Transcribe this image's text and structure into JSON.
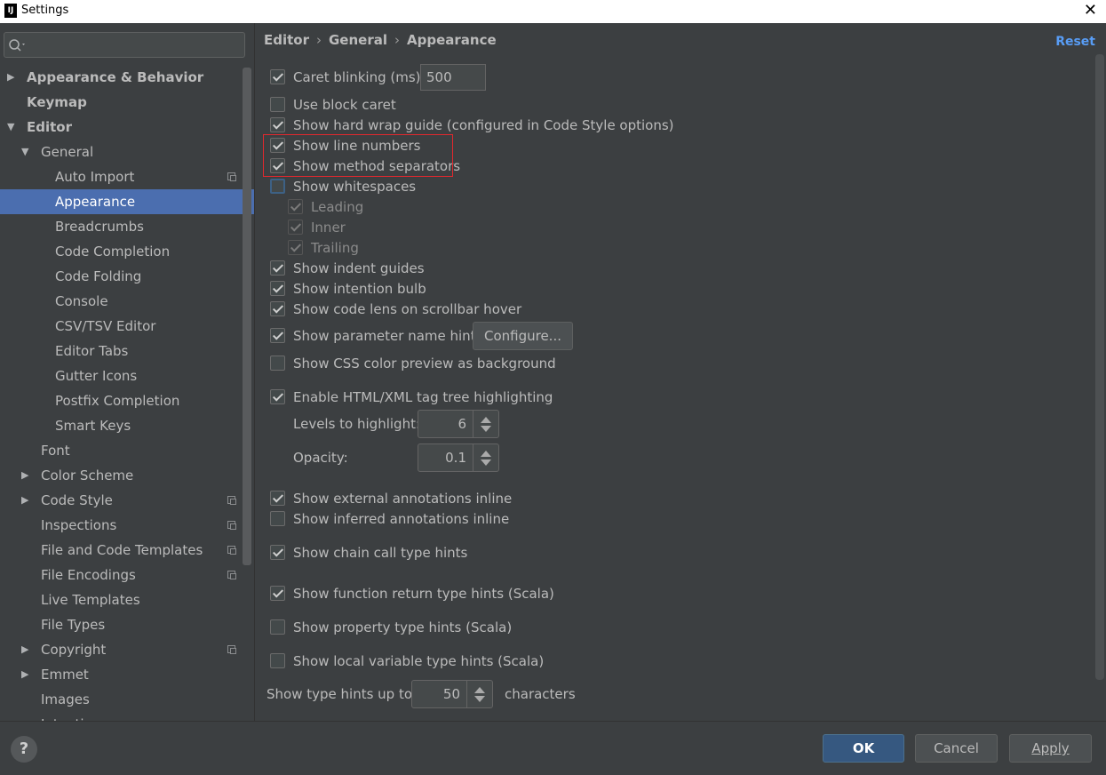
{
  "window": {
    "title": "Settings",
    "app_icon_text": "IJ"
  },
  "search": {
    "placeholder": "",
    "icon": "search-icon"
  },
  "sidebar": {
    "items": [
      {
        "label": "Appearance & Behavior",
        "level": 0,
        "arrow": "collapsed",
        "bold": true
      },
      {
        "label": "Keymap",
        "level": 0,
        "bold": true
      },
      {
        "label": "Editor",
        "level": 0,
        "arrow": "expanded",
        "bold": true
      },
      {
        "label": "General",
        "level": 1,
        "arrow": "expanded"
      },
      {
        "label": "Auto Import",
        "level": 2,
        "project": true
      },
      {
        "label": "Appearance",
        "level": 2,
        "selected": true
      },
      {
        "label": "Breadcrumbs",
        "level": 2
      },
      {
        "label": "Code Completion",
        "level": 2
      },
      {
        "label": "Code Folding",
        "level": 2
      },
      {
        "label": "Console",
        "level": 2
      },
      {
        "label": "CSV/TSV Editor",
        "level": 2
      },
      {
        "label": "Editor Tabs",
        "level": 2
      },
      {
        "label": "Gutter Icons",
        "level": 2
      },
      {
        "label": "Postfix Completion",
        "level": 2
      },
      {
        "label": "Smart Keys",
        "level": 2
      },
      {
        "label": "Font",
        "level": 1
      },
      {
        "label": "Color Scheme",
        "level": 1,
        "arrow": "collapsed"
      },
      {
        "label": "Code Style",
        "level": 1,
        "arrow": "collapsed",
        "project": true
      },
      {
        "label": "Inspections",
        "level": 1,
        "project": true
      },
      {
        "label": "File and Code Templates",
        "level": 1,
        "project": true
      },
      {
        "label": "File Encodings",
        "level": 1,
        "project": true
      },
      {
        "label": "Live Templates",
        "level": 1
      },
      {
        "label": "File Types",
        "level": 1
      },
      {
        "label": "Copyright",
        "level": 1,
        "arrow": "collapsed",
        "project": true
      },
      {
        "label": "Emmet",
        "level": 1,
        "arrow": "collapsed"
      },
      {
        "label": "Images",
        "level": 1
      },
      {
        "label": "Intentions",
        "level": 1
      }
    ]
  },
  "breadcrumb": {
    "items": [
      "Editor",
      "General",
      "Appearance"
    ],
    "separator": "›"
  },
  "reset_label": "Reset",
  "options": {
    "caret_blinking": {
      "label": "Caret blinking (ms):",
      "checked": true,
      "value": "500"
    },
    "block_caret": {
      "label": "Use block caret",
      "checked": false
    },
    "hard_wrap": {
      "label": "Show hard wrap guide (configured in Code Style options)",
      "checked": true
    },
    "line_numbers": {
      "label": "Show line numbers",
      "checked": true
    },
    "method_separators": {
      "label": "Show method separators",
      "checked": true
    },
    "whitespaces": {
      "label": "Show whitespaces",
      "checked": false
    },
    "leading": {
      "label": "Leading",
      "checked": true
    },
    "inner": {
      "label": "Inner",
      "checked": true
    },
    "trailing": {
      "label": "Trailing",
      "checked": true
    },
    "indent_guides": {
      "label": "Show indent guides",
      "checked": true
    },
    "intention_bulb": {
      "label": "Show intention bulb",
      "checked": true
    },
    "code_lens": {
      "label": "Show code lens on scrollbar hover",
      "checked": true
    },
    "param_hints": {
      "label": "Show parameter name hints",
      "checked": true,
      "button": "Configure..."
    },
    "css_color": {
      "label": "Show CSS color preview as background",
      "checked": false
    },
    "html_tag_tree": {
      "label": "Enable HTML/XML tag tree highlighting",
      "checked": true
    },
    "levels": {
      "label": "Levels to highlight:",
      "value": "6"
    },
    "opacity": {
      "label": "Opacity:",
      "value": "0.1"
    },
    "external_annotations": {
      "label": "Show external annotations inline",
      "checked": true
    },
    "inferred_annotations": {
      "label": "Show inferred annotations inline",
      "checked": false
    },
    "chain_call": {
      "label": "Show chain call type hints",
      "checked": true
    },
    "function_return": {
      "label": "Show function return type hints (Scala)",
      "checked": true
    },
    "property_type": {
      "label": "Show property type hints (Scala)",
      "checked": false
    },
    "local_variable": {
      "label": "Show local variable type hints (Scala)",
      "checked": false
    },
    "type_hints_up_to": {
      "label": "Show type hints up to:",
      "value": "50",
      "suffix": "characters"
    }
  },
  "buttons": {
    "help": "?",
    "ok": "OK",
    "cancel": "Cancel",
    "apply": "Apply"
  },
  "colors": {
    "background": "#3c3f41",
    "selection": "#4b6eaf",
    "link": "#589df6",
    "highlight_box": "#e0282e",
    "primary_button": "#365880"
  }
}
